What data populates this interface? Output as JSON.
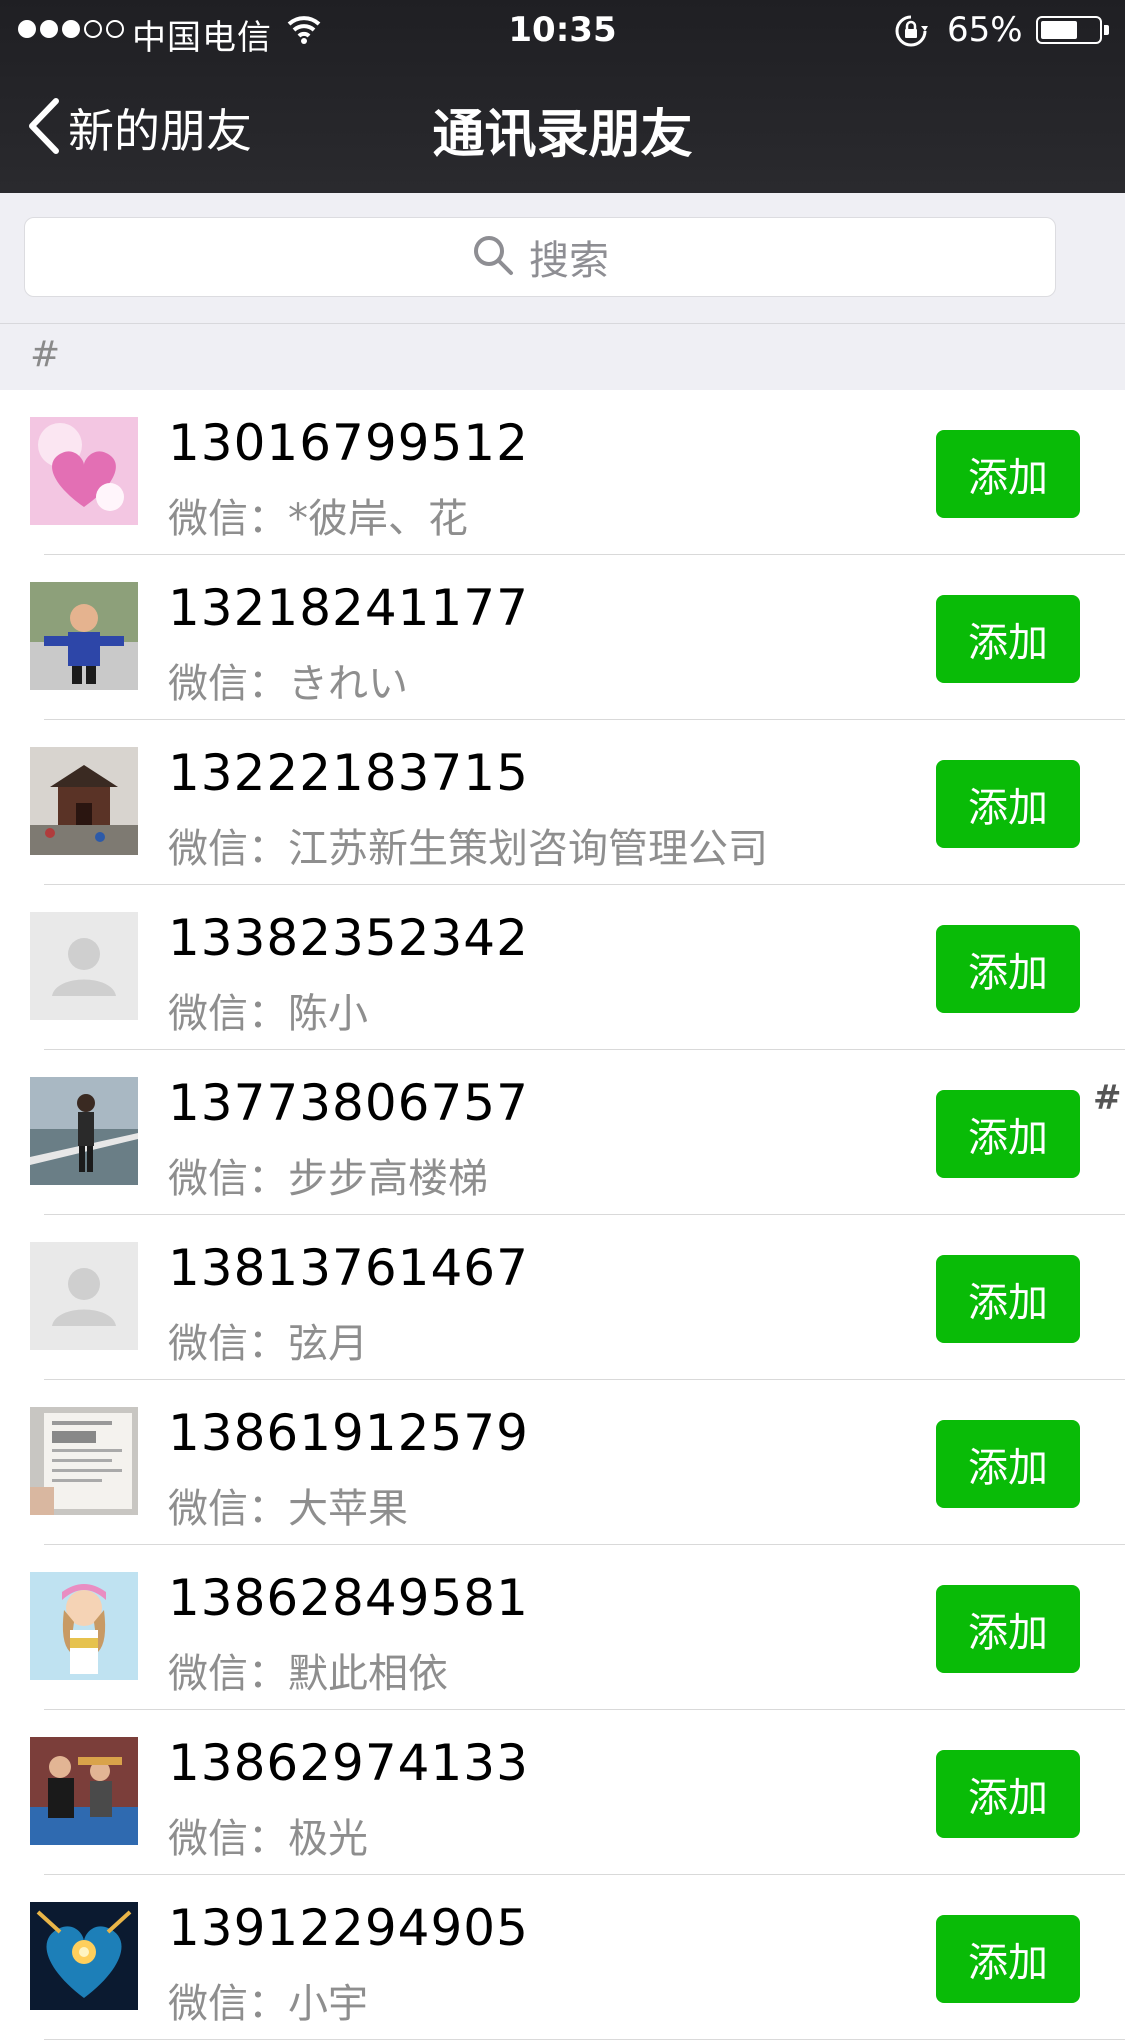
{
  "status_bar": {
    "carrier": "中国电信",
    "time": "10:35",
    "battery_percent": "65%",
    "battery_level": 0.65,
    "signal_bars": 3,
    "signal_total": 5
  },
  "nav": {
    "back_label": "新的朋友",
    "title": "通讯录朋友"
  },
  "search": {
    "placeholder": "搜索"
  },
  "section_header": "#",
  "index_letter": "#",
  "wechat_prefix": "微信：",
  "add_label": "添加",
  "contacts": [
    {
      "phone": "13016799512",
      "wechat": "微信：*彼岸、花",
      "avatar": "pink-heart-photo"
    },
    {
      "phone": "13218241177",
      "wechat": "微信：きれい",
      "avatar": "child-photo"
    },
    {
      "phone": "13222183715",
      "wechat": "微信：江苏新生策划咨询管理公司",
      "avatar": "pavilion-photo"
    },
    {
      "phone": "13382352342",
      "wechat": "微信：陈小",
      "avatar": "default-avatar"
    },
    {
      "phone": "13773806757",
      "wechat": "微信：步步高楼梯",
      "avatar": "person-bridge-photo"
    },
    {
      "phone": "13813761467",
      "wechat": "微信：弦月",
      "avatar": "default-avatar"
    },
    {
      "phone": "13861912579",
      "wechat": "微信：大苹果",
      "avatar": "ticket-photo"
    },
    {
      "phone": "13862849581",
      "wechat": "微信：默此相依",
      "avatar": "girl-photo"
    },
    {
      "phone": "13862974133",
      "wechat": "微信：极光",
      "avatar": "couple-photo"
    },
    {
      "phone": "13912294905",
      "wechat": "微信：小宇",
      "avatar": "blue-heart-art"
    }
  ],
  "colors": {
    "accent_green": "#09bb07",
    "nav_bg": "#1f1f23",
    "page_bg": "#efeff4"
  }
}
